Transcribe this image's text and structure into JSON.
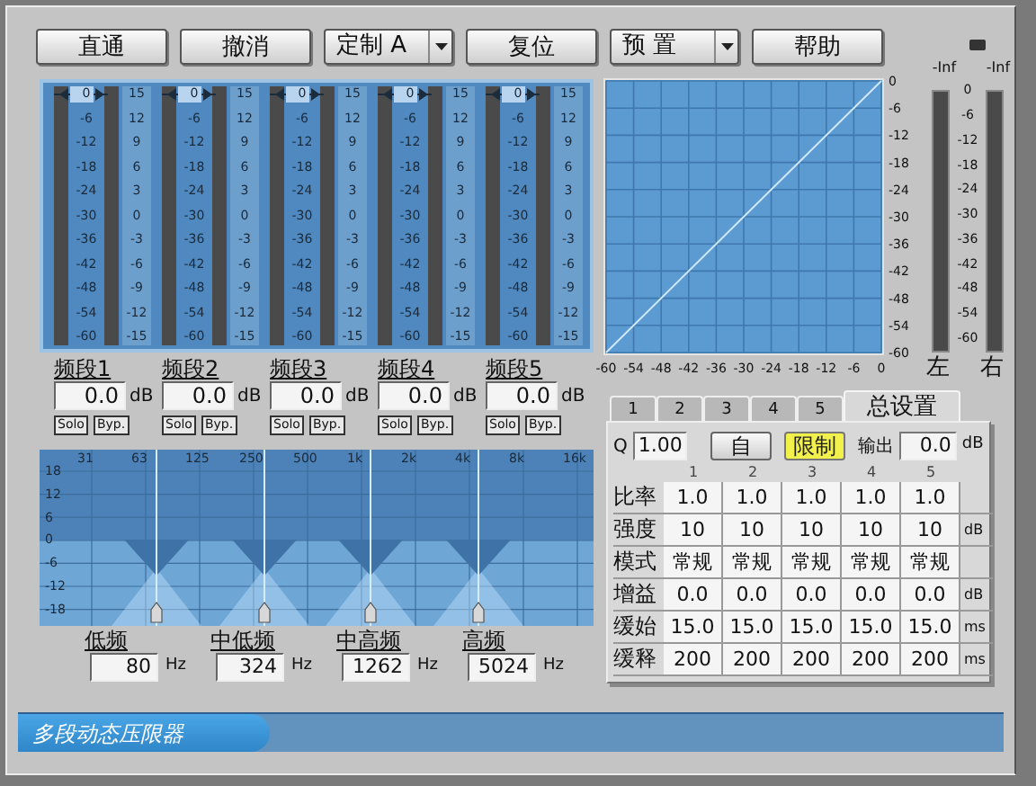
{
  "toolbar": [
    {
      "label": "直通",
      "kind": "button"
    },
    {
      "label": "撤消",
      "kind": "button"
    },
    {
      "label": "定制 A",
      "kind": "dropdown"
    },
    {
      "label": "复位",
      "kind": "button"
    },
    {
      "label": "预 置",
      "kind": "dropdown"
    },
    {
      "label": "帮助",
      "kind": "button"
    }
  ],
  "bands": [
    {
      "label": "频段1",
      "level": 1,
      "value": "0.0",
      "unit": "dB",
      "solo": "Solo",
      "bypass": "Byp.",
      "threshold_scale": [
        "0",
        "-6",
        "-12",
        "-18",
        "-24",
        "-30",
        "-36",
        "-42",
        "-48",
        "-54",
        "-60"
      ],
      "gain_scale": [
        "15",
        "12",
        "9",
        "6",
        "3",
        "0",
        "-3",
        "-6",
        "-9",
        "-12",
        "-15"
      ]
    },
    {
      "label": "频段2",
      "level": 1,
      "value": "0.0",
      "unit": "dB",
      "solo": "Solo",
      "bypass": "Byp.",
      "threshold_scale": [
        "0",
        "-6",
        "-12",
        "-18",
        "-24",
        "-30",
        "-36",
        "-42",
        "-48",
        "-54",
        "-60"
      ],
      "gain_scale": [
        "15",
        "12",
        "9",
        "6",
        "3",
        "0",
        "-3",
        "-6",
        "-9",
        "-12",
        "-15"
      ]
    },
    {
      "label": "频段3",
      "level": 1,
      "value": "0.0",
      "unit": "dB",
      "solo": "Solo",
      "bypass": "Byp.",
      "threshold_scale": [
        "0",
        "-6",
        "-12",
        "-18",
        "-24",
        "-30",
        "-36",
        "-42",
        "-48",
        "-54",
        "-60"
      ],
      "gain_scale": [
        "15",
        "12",
        "9",
        "6",
        "3",
        "0",
        "-3",
        "-6",
        "-9",
        "-12",
        "-15"
      ]
    },
    {
      "label": "频段4",
      "level": 1,
      "value": "0.0",
      "unit": "dB",
      "solo": "Solo",
      "bypass": "Byp.",
      "threshold_scale": [
        "0",
        "-6",
        "-12",
        "-18",
        "-24",
        "-30",
        "-36",
        "-42",
        "-48",
        "-54",
        "-60"
      ],
      "gain_scale": [
        "15",
        "12",
        "9",
        "6",
        "3",
        "0",
        "-3",
        "-6",
        "-9",
        "-12",
        "-15"
      ]
    },
    {
      "label": "频段5",
      "level": 1,
      "value": "0.0",
      "unit": "dB",
      "solo": "Solo",
      "bypass": "Byp.",
      "threshold_scale": [
        "0",
        "-6",
        "-12",
        "-18",
        "-24",
        "-30",
        "-36",
        "-42",
        "-48",
        "-54",
        "-60"
      ],
      "gain_scale": [
        "15",
        "12",
        "9",
        "6",
        "3",
        "0",
        "-3",
        "-6",
        "-9",
        "-12",
        "-15"
      ]
    }
  ],
  "transfer_curve": {
    "chart_data": {
      "type": "line",
      "grid": true,
      "x": [
        -60,
        0
      ],
      "series": [
        {
          "color": "#cfe8fb",
          "values": [
            -60,
            0
          ]
        }
      ],
      "xlim": [
        -60,
        0
      ],
      "ylim": [
        -60,
        0
      ],
      "xticks": [
        -60,
        -54,
        -48,
        -42,
        -36,
        -30,
        -24,
        -18,
        -12,
        -6,
        0
      ],
      "yticks": [
        0,
        -6,
        -12,
        -18,
        -24,
        -30,
        -36,
        -42,
        -48,
        -54,
        -60
      ]
    }
  },
  "meters": {
    "scale": [
      "0",
      "-6",
      "-12",
      "-18",
      "-24",
      "-30",
      "-36",
      "-42",
      "-48",
      "-54",
      "-60"
    ],
    "channels": [
      {
        "peak": "-Inf",
        "label": "左"
      },
      {
        "peak": "-Inf",
        "label": "右"
      }
    ]
  },
  "eq_graph": {
    "freq_labels": [
      "31",
      "63",
      "125",
      "250",
      "500",
      "1k",
      "2k",
      "4k",
      "8k",
      "16k"
    ],
    "db_labels": [
      "18",
      "12",
      "6",
      "0",
      "-6",
      "-12",
      "-18"
    ]
  },
  "crossovers": [
    {
      "label": "低频",
      "value": "80",
      "unit": "Hz"
    },
    {
      "label": "中低频",
      "value": "324",
      "unit": "Hz"
    },
    {
      "label": "中高频",
      "value": "1262",
      "unit": "Hz"
    },
    {
      "label": "高频",
      "value": "5024",
      "unit": "Hz"
    }
  ],
  "settings": {
    "tabs": [
      {
        "label": "1",
        "selected": false
      },
      {
        "label": "2",
        "selected": false
      },
      {
        "label": "3",
        "selected": false
      },
      {
        "label": "4",
        "selected": false
      },
      {
        "label": "5",
        "selected": false
      },
      {
        "label": "总设置",
        "selected": true
      }
    ],
    "q_label": "Q",
    "q_value": "1.00",
    "auto_button": {
      "label": "自",
      "on": false
    },
    "limit_button": {
      "label": "限制",
      "on": true
    },
    "output_label": "输出",
    "output_value": "0.0",
    "output_unit": "dB",
    "columns": [
      "1",
      "2",
      "3",
      "4",
      "5"
    ],
    "rows": [
      {
        "label": "比率",
        "values": [
          "1.0",
          "1.0",
          "1.0",
          "1.0",
          "1.0"
        ]
      },
      {
        "label": "强度",
        "values": [
          "10",
          "10",
          "10",
          "10",
          "10"
        ],
        "unit": "dB"
      },
      {
        "label": "模式",
        "values": [
          "常规",
          "常规",
          "常规",
          "常规",
          "常规"
        ]
      },
      {
        "label": "增益",
        "values": [
          "0.0",
          "0.0",
          "0.0",
          "0.0",
          "0.0"
        ],
        "unit": "dB"
      },
      {
        "label": "缓始",
        "values": [
          "15.0",
          "15.0",
          "15.0",
          "15.0",
          "15.0"
        ],
        "unit": "ms"
      },
      {
        "label": "缓释",
        "values": [
          "200",
          "200",
          "200",
          "200",
          "200"
        ],
        "unit": "ms"
      }
    ]
  },
  "footer": {
    "title": "多段动态压限器"
  }
}
